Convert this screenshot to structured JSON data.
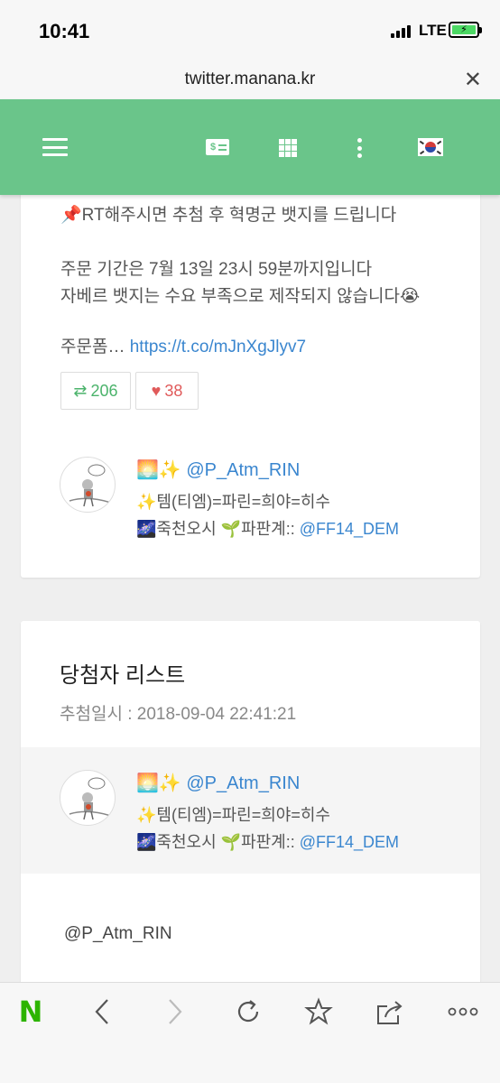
{
  "status_bar": {
    "time": "10:41",
    "network": "LTE"
  },
  "browser": {
    "url": "twitter.manana.kr"
  },
  "tweet": {
    "line1": "📌RT해주시면 추첨 후 혁명군 뱃지를 드립니다",
    "line2": "주문 기간은 7월 13일 23시 59분까지입니다",
    "line3": "자베르 뱃지는 수요 부족으로 제작되지 않습니다😭",
    "line4_prefix": "주문폼… ",
    "line4_link": "https://t.co/mJnXgJlyv7",
    "retweets": "206",
    "likes": "38"
  },
  "author": {
    "name_prefix": "🌅✨",
    "handle": "@P_Atm_RIN",
    "bio1": "✨템(티엠)=파린=희야=히수",
    "bio2_prefix": "🌌죽천오시 🌱파판계:: ",
    "bio2_link": "@FF14_DEM"
  },
  "winners": {
    "title": "당첨자 리스트",
    "date": "추첨일시 : 2018-09-04 22:41:21",
    "winner_handle": "@P_Atm_RIN"
  },
  "icons": {
    "menu": "hamburger-icon",
    "money": "money-icon",
    "grid": "grid-icon",
    "more": "kebab-icon",
    "flag": "korea-flag-icon"
  },
  "colors": {
    "accent": "#6ac58a",
    "link": "#3a86cf",
    "retweet": "#4bb36b",
    "like": "#e05a5a"
  }
}
